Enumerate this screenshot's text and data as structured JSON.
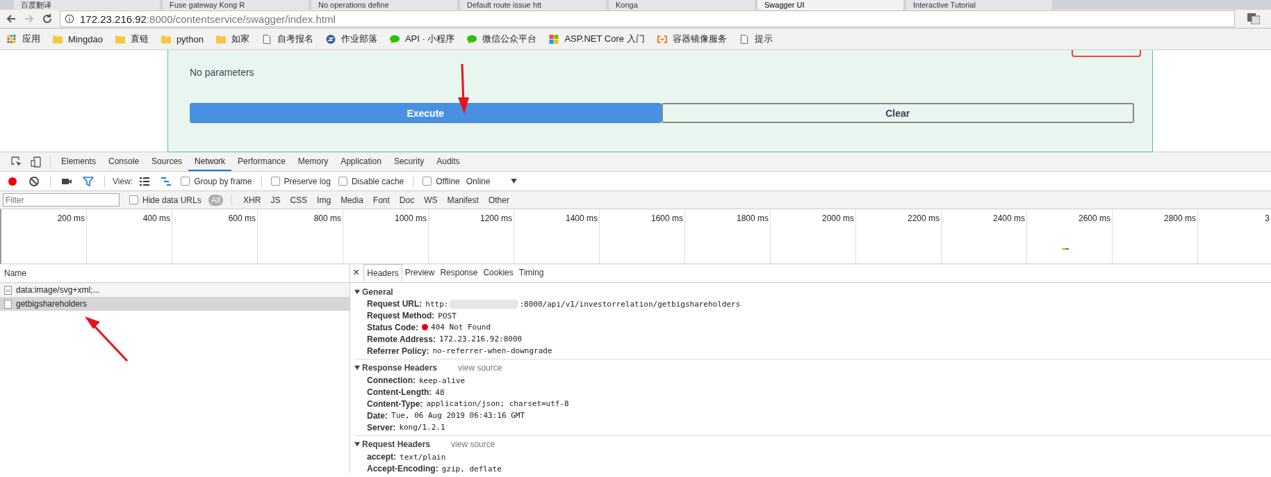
{
  "browser_tabs": [
    {
      "title": "百度翻译",
      "selected": false
    },
    {
      "title": "Fuse gateway Kong R",
      "selected": false
    },
    {
      "title": "No operations define",
      "selected": false
    },
    {
      "title": "Default route issue htt",
      "selected": false
    },
    {
      "title": "Konga",
      "selected": false
    },
    {
      "title": "Swagger UI",
      "selected": true
    },
    {
      "title": "Interactive Tutorial",
      "selected": false
    }
  ],
  "address_bar": {
    "host": "172.23.216.92",
    "path": ":8000/contentservice/swagger/index.html"
  },
  "bookmarks": [
    {
      "label": "应用",
      "kind": "apps"
    },
    {
      "label": "Mingdao",
      "kind": "folder"
    },
    {
      "label": "直链",
      "kind": "folder"
    },
    {
      "label": "python",
      "kind": "folder"
    },
    {
      "label": "如家",
      "kind": "folder"
    },
    {
      "label": "自考报名",
      "kind": "page"
    },
    {
      "label": "作业部落",
      "kind": "site"
    },
    {
      "label": "API · 小程序",
      "kind": "chat"
    },
    {
      "label": "微信公众平台",
      "kind": "chat"
    },
    {
      "label": "ASP.NET Core 入门",
      "kind": "windows"
    },
    {
      "label": "容器镜像服务",
      "kind": "cloud"
    },
    {
      "label": "提示",
      "kind": "page"
    }
  ],
  "swagger": {
    "message": "No parameters",
    "buttons": [
      {
        "label": "Execute",
        "kind": "primary"
      },
      {
        "label": "Clear",
        "kind": "secondary"
      }
    ]
  },
  "devtools": {
    "tabs": [
      {
        "label": "Elements",
        "selected": false
      },
      {
        "label": "Console",
        "selected": false
      },
      {
        "label": "Sources",
        "selected": false
      },
      {
        "label": "Network",
        "selected": true
      },
      {
        "label": "Performance",
        "selected": false
      },
      {
        "label": "Memory",
        "selected": false
      },
      {
        "label": "Application",
        "selected": false
      },
      {
        "label": "Security",
        "selected": false
      },
      {
        "label": "Audits",
        "selected": false
      }
    ],
    "toolbar": {
      "recording": true,
      "view_label": "View:",
      "checkboxes": [
        {
          "label": "Group by frame",
          "checked": false
        },
        {
          "label": "Preserve log",
          "checked": false
        },
        {
          "label": "Disable cache",
          "checked": false
        },
        {
          "label": "Offline",
          "checked": false
        }
      ],
      "throttle": "Online"
    },
    "filter": {
      "placeholder": "Filter",
      "hide_data_urls": {
        "label": "Hide data URLs",
        "checked": false
      },
      "types": [
        {
          "label": "All",
          "selected": true
        },
        {
          "label": "XHR",
          "selected": false
        },
        {
          "label": "JS",
          "selected": false
        },
        {
          "label": "CSS",
          "selected": false
        },
        {
          "label": "Img",
          "selected": false
        },
        {
          "label": "Media",
          "selected": false
        },
        {
          "label": "Font",
          "selected": false
        },
        {
          "label": "Doc",
          "selected": false
        },
        {
          "label": "WS",
          "selected": false
        },
        {
          "label": "Manifest",
          "selected": false
        },
        {
          "label": "Other",
          "selected": false
        }
      ]
    },
    "timeline_ticks": [
      "200 ms",
      "400 ms",
      "600 ms",
      "800 ms",
      "1000 ms",
      "1200 ms",
      "1400 ms",
      "1600 ms",
      "1800 ms",
      "2000 ms",
      "2200 ms",
      "2400 ms",
      "2600 ms",
      "2800 ms",
      "3"
    ],
    "requests": {
      "column": "Name",
      "rows": [
        {
          "name": "data:image/svg+xml;...",
          "kind": "image",
          "selected": false
        },
        {
          "name": "getbigshareholders",
          "kind": "document",
          "selected": true
        }
      ]
    },
    "detail_close": "×",
    "detail_tabs": [
      {
        "label": "Headers",
        "selected": true
      },
      {
        "label": "Preview",
        "selected": false
      },
      {
        "label": "Response",
        "selected": false
      },
      {
        "label": "Cookies",
        "selected": false
      },
      {
        "label": "Timing",
        "selected": false
      }
    ],
    "sections": [
      {
        "title": "General",
        "expanded": true,
        "headers": [
          {
            "name": "Request URL:",
            "value": "http:",
            "redacted": true,
            "value_after": ":8000/api/v1/investorrelation/getbigshareholders"
          },
          {
            "name": "Request Method:",
            "value": "POST"
          },
          {
            "name": "Status Code:",
            "value": "404 Not Found",
            "color": "#e8000b"
          },
          {
            "name": "Remote Address:",
            "value": "172.23.216.92:8000"
          },
          {
            "name": "Referrer Policy:",
            "value": "no-referrer-when-downgrade"
          }
        ]
      },
      {
        "title": "Response Headers",
        "view_source": "view source",
        "expanded": true,
        "headers": [
          {
            "name": "Connection:",
            "value": "keep-alive"
          },
          {
            "name": "Content-Length:",
            "value": "48"
          },
          {
            "name": "Content-Type:",
            "value": "application/json; charset=utf-8"
          },
          {
            "name": "Date:",
            "value": "Tue, 06 Aug 2019 06:43:16 GMT"
          },
          {
            "name": "Server:",
            "value": "kong/1.2.1"
          }
        ]
      },
      {
        "title": "Request Headers",
        "view_source": "view source",
        "expanded": true,
        "headers": [
          {
            "name": "accept:",
            "value": "text/plain"
          },
          {
            "name": "Accept-Encoding:",
            "value": "gzip, deflate"
          }
        ]
      }
    ]
  }
}
